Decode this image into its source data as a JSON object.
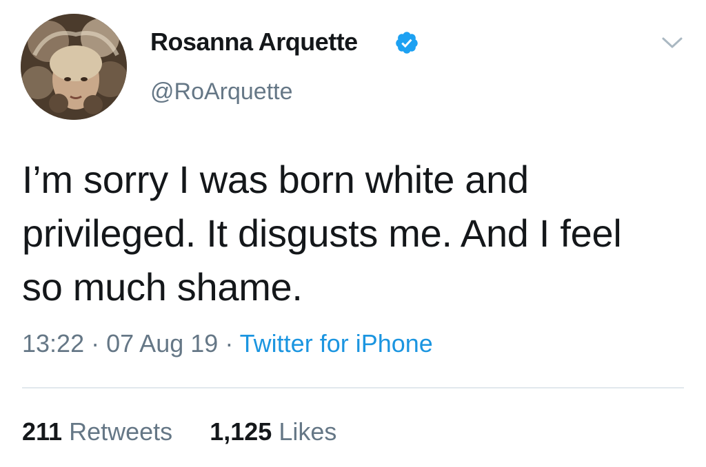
{
  "author": {
    "display_name": "Rosanna Arquette",
    "handle": "@RoArquette",
    "verified": true
  },
  "tweet": {
    "text": "I’m sorry I was born white and privileged. It disgusts me. And I feel so much shame.",
    "time": "13:22",
    "date": "07 Aug 19",
    "separator": "·",
    "source": "Twitter for iPhone"
  },
  "stats": {
    "retweets_count": "211",
    "retweets_label": "Retweets",
    "likes_count": "1,125",
    "likes_label": "Likes"
  },
  "icons": {
    "verified": "verified-badge-icon",
    "caret": "chevron-down-icon"
  },
  "colors": {
    "text": "#14171a",
    "secondary": "#657786",
    "link": "#1b95e0",
    "verified": "#1da1f2",
    "divider": "#e1e8ed"
  }
}
